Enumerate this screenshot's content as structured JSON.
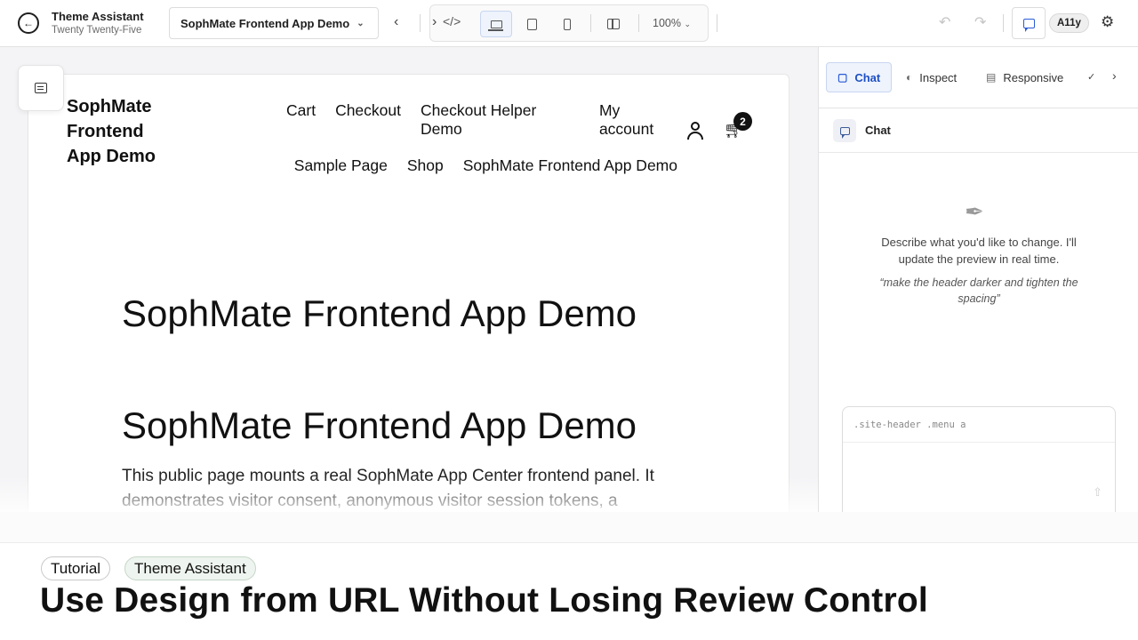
{
  "topbar": {
    "app_title": "Theme Assistant",
    "theme_name": "Twenty Twenty-Five",
    "page_select": "SophMate Frontend App Demo",
    "zoom": "100%",
    "a11y": "A11y",
    "active_device": "desktop"
  },
  "site": {
    "title": "SophMate Frontend App Demo",
    "nav_row1": [
      "Cart",
      "Checkout",
      "Checkout Helper Demo",
      "My account"
    ],
    "nav_row2": [
      "Sample Page",
      "Shop",
      "SophMate Frontend App Demo"
    ],
    "cart_count": "2",
    "heading1": "SophMate Frontend App Demo",
    "heading2": "SophMate Frontend App Demo",
    "intro": "This public page mounts a real SophMate App Center frontend panel. It demonstrates visitor consent, anonymous visitor session tokens, a"
  },
  "panel": {
    "tabs": [
      "Chat",
      "Inspect",
      "Responsive"
    ],
    "active_tab": "Chat",
    "chat_title": "Chat",
    "empty_message": "Describe what you'd like to change. I'll update the preview in real time.",
    "example": "“make the header darker and tighten the spacing”",
    "selector": ".site-header .menu a"
  },
  "caption": {
    "tags": [
      "Tutorial",
      "Theme Assistant"
    ],
    "title": "Use Design from URL Without Losing Review Control"
  },
  "colors": {
    "accent": "#2a5bd7",
    "text": "#111111",
    "border": "#e2e2e2"
  }
}
